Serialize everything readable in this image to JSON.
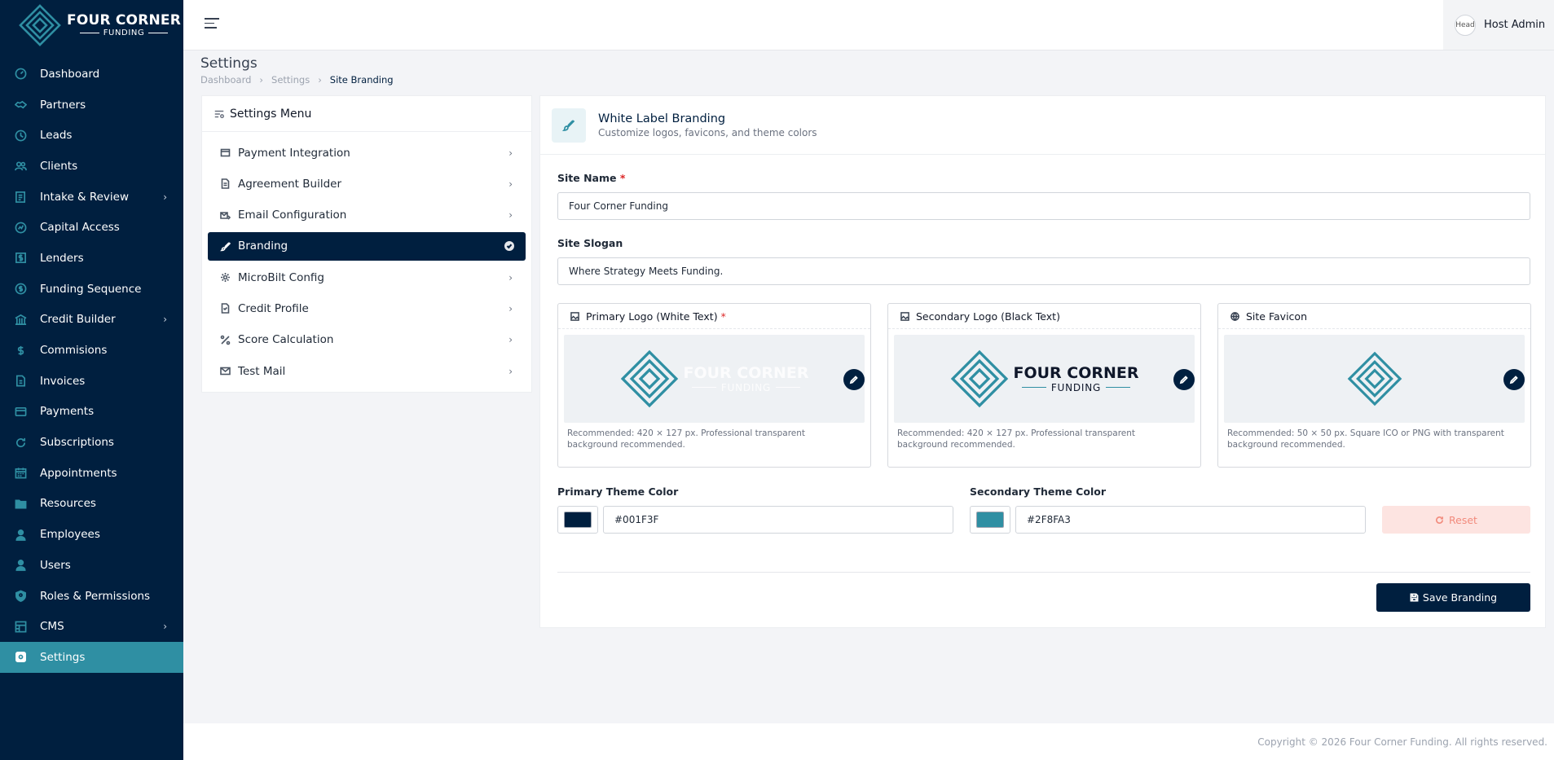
{
  "brand": {
    "name_line1": "FOUR CORNER",
    "name_line2": "FUNDING"
  },
  "sidebar": {
    "items": [
      {
        "label": "Dashboard",
        "icon": "gauge-icon"
      },
      {
        "label": "Partners",
        "icon": "handshake-icon"
      },
      {
        "label": "Leads",
        "icon": "clock-icon"
      },
      {
        "label": "Clients",
        "icon": "users-icon"
      },
      {
        "label": "Intake & Review",
        "icon": "clipboard-icon",
        "has_children": true
      },
      {
        "label": "Capital Access",
        "icon": "chart-icon"
      },
      {
        "label": "Lenders",
        "icon": "dollar-box-icon"
      },
      {
        "label": "Funding Sequence",
        "icon": "coin-icon"
      },
      {
        "label": "Credit Builder",
        "icon": "bank-icon",
        "has_children": true
      },
      {
        "label": "Commisions",
        "icon": "dollar-icon"
      },
      {
        "label": "Invoices",
        "icon": "file-icon"
      },
      {
        "label": "Payments",
        "icon": "card-icon"
      },
      {
        "label": "Subscriptions",
        "icon": "refresh-icon"
      },
      {
        "label": "Appointments",
        "icon": "calendar-icon"
      },
      {
        "label": "Resources",
        "icon": "folder-icon"
      },
      {
        "label": "Employees",
        "icon": "person-icon"
      },
      {
        "label": "Users",
        "icon": "user-icon"
      },
      {
        "label": "Roles & Permissions",
        "icon": "shield-icon"
      },
      {
        "label": "CMS",
        "icon": "grid-icon",
        "has_children": true
      },
      {
        "label": "Settings",
        "icon": "settings-icon",
        "active": true
      }
    ]
  },
  "header": {
    "user_name": "Host Admin",
    "avatar_alt": "Head"
  },
  "page": {
    "title": "Settings",
    "breadcrumb": [
      "Dashboard",
      "Settings",
      "Site Branding"
    ]
  },
  "settings_menu": {
    "title": "Settings Menu",
    "items": [
      {
        "label": "Payment Integration"
      },
      {
        "label": "Agreement Builder"
      },
      {
        "label": "Email Configuration"
      },
      {
        "label": "Branding",
        "active": true
      },
      {
        "label": "MicroBilt Config"
      },
      {
        "label": "Credit Profile"
      },
      {
        "label": "Score Calculation"
      },
      {
        "label": "Test Mail"
      }
    ]
  },
  "branding": {
    "title": "White Label Branding",
    "subtitle": "Customize logos, favicons, and theme colors",
    "site_name_label": "Site Name",
    "site_name_value": "Four Corner Funding",
    "site_slogan_label": "Site Slogan",
    "site_slogan_value": "Where Strategy Meets Funding.",
    "primary_logo": {
      "label": "Primary Logo (White Text)",
      "note": "Recommended: 420 × 127 px. Professional transparent background recommended."
    },
    "secondary_logo": {
      "label": "Secondary Logo (Black Text)",
      "note": "Recommended: 420 × 127 px. Professional transparent background recommended."
    },
    "favicon": {
      "label": "Site Favicon",
      "note": "Recommended: 50 × 50 px. Square ICO or PNG with transparent background recommended."
    },
    "logo_text": {
      "line1": "FOUR CORNER",
      "line2": "FUNDING"
    },
    "primary_color_label": "Primary Theme Color",
    "primary_color_value": "#001F3F",
    "secondary_color_label": "Secondary Theme Color",
    "secondary_color_value": "#2F8FA3",
    "reset_label": "Reset",
    "save_label": "Save Branding"
  },
  "footer": {
    "copyright": "Copyright © 2026 Four Corner Funding. All rights reserved."
  },
  "colors": {
    "primary": "#001F3F",
    "accent": "#2F8FA3",
    "danger": "#dc2626"
  }
}
